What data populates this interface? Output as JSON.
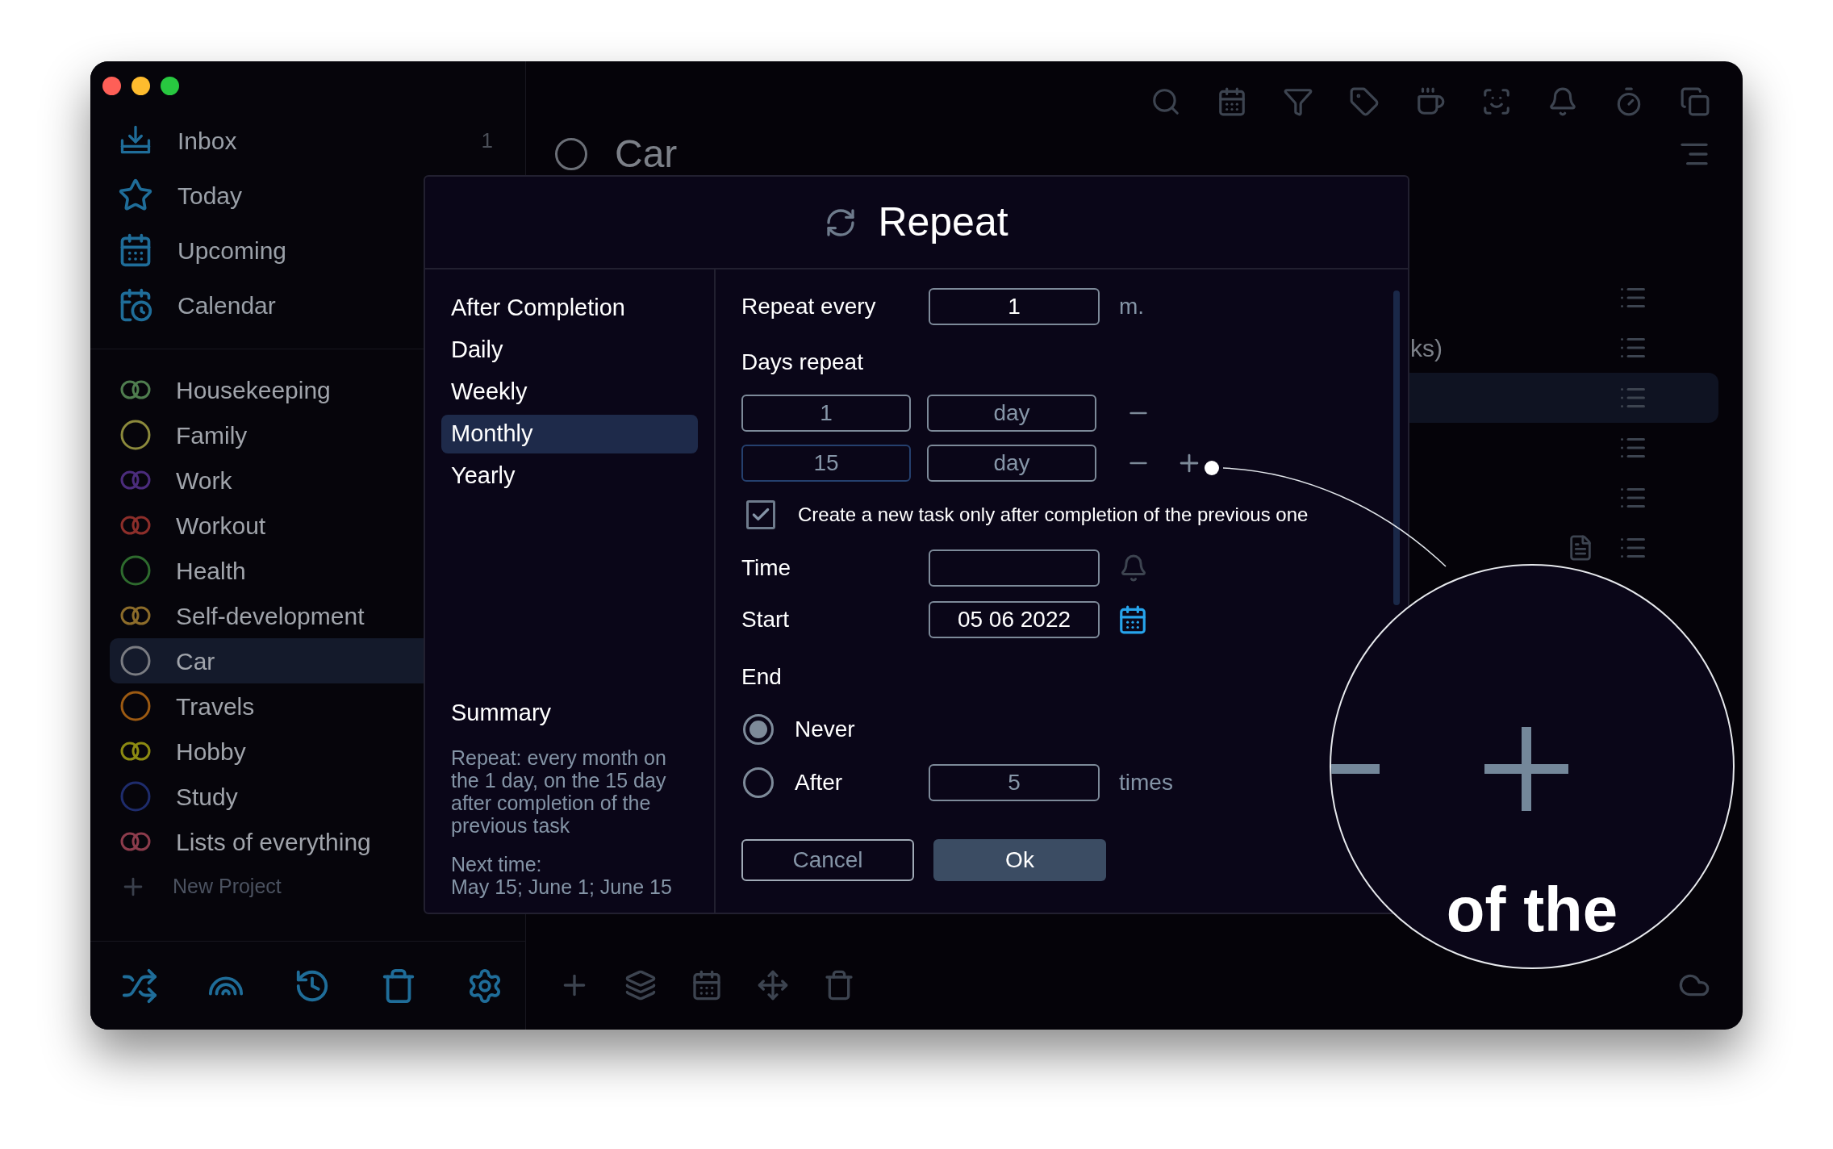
{
  "sidebar": {
    "nav": [
      {
        "kind": "inbox",
        "label": "Inbox",
        "count": "1"
      },
      {
        "kind": "today",
        "label": "Today"
      },
      {
        "kind": "upcoming",
        "label": "Upcoming"
      },
      {
        "kind": "calendar",
        "label": "Calendar"
      }
    ],
    "projects": [
      {
        "name": "Housekeeping",
        "color": "#4f7d4f",
        "kind": "double",
        "selected": false
      },
      {
        "name": "Family",
        "color": "#8c8a3c",
        "kind": "single",
        "selected": false
      },
      {
        "name": "Work",
        "color": "#4b2c7c",
        "kind": "double",
        "selected": false
      },
      {
        "name": "Workout",
        "color": "#8c2e2a",
        "kind": "double",
        "selected": false
      },
      {
        "name": "Health",
        "color": "#2e6b2e",
        "kind": "single",
        "selected": false
      },
      {
        "name": "Self-development",
        "color": "#8c6c2a",
        "kind": "double",
        "selected": false
      },
      {
        "name": "Car",
        "color": "#7a7c82",
        "kind": "single",
        "selected": true
      },
      {
        "name": "Travels",
        "color": "#9c5a12",
        "kind": "single",
        "selected": false
      },
      {
        "name": "Hobby",
        "color": "#8c8a12",
        "kind": "double",
        "selected": false
      },
      {
        "name": "Study",
        "color": "#1e2c6c",
        "kind": "single",
        "selected": false
      },
      {
        "name": "Lists of everything",
        "color": "#8c3c4c",
        "kind": "double",
        "selected": false
      }
    ],
    "new_project": "New Project"
  },
  "main": {
    "title": "Car",
    "rows": [
      {
        "selected": false
      },
      {
        "text": "ks)",
        "selected": false
      },
      {
        "selected": true
      },
      {
        "selected": false
      },
      {
        "selected": false
      },
      {
        "selected": false,
        "note": true
      }
    ]
  },
  "dialog": {
    "title": "Repeat",
    "modes": [
      {
        "label": "After Completion",
        "selected": false
      },
      {
        "label": "Daily",
        "selected": false
      },
      {
        "label": "Weekly",
        "selected": false
      },
      {
        "label": "Monthly",
        "selected": true
      },
      {
        "label": "Yearly",
        "selected": false
      }
    ],
    "summary": {
      "title": "Summary",
      "text": "Repeat: every month on the 1 day, on the 15 day after completion of the previous task",
      "next_label": "Next time:",
      "next": "May 15; June 1; June 15"
    },
    "repeat_every": {
      "label": "Repeat every",
      "value": "1",
      "unit": "m."
    },
    "days_repeat": {
      "label": "Days repeat",
      "entries": [
        {
          "day": "1",
          "unit": "day",
          "focused": false
        },
        {
          "day": "15",
          "unit": "day",
          "focused": true
        }
      ]
    },
    "only_after_completion": {
      "label": "Create a new task only after completion of the previous one",
      "checked": true
    },
    "time": {
      "label": "Time"
    },
    "start": {
      "label": "Start",
      "value": "05 06 2022"
    },
    "end": {
      "label": "End",
      "options": [
        {
          "label": "Never",
          "selected": true
        },
        {
          "label": "After",
          "selected": false
        }
      ],
      "count": "5",
      "unit": "times"
    },
    "cancel": "Cancel",
    "ok": "Ok"
  },
  "magnifier": {
    "text": "of the"
  }
}
